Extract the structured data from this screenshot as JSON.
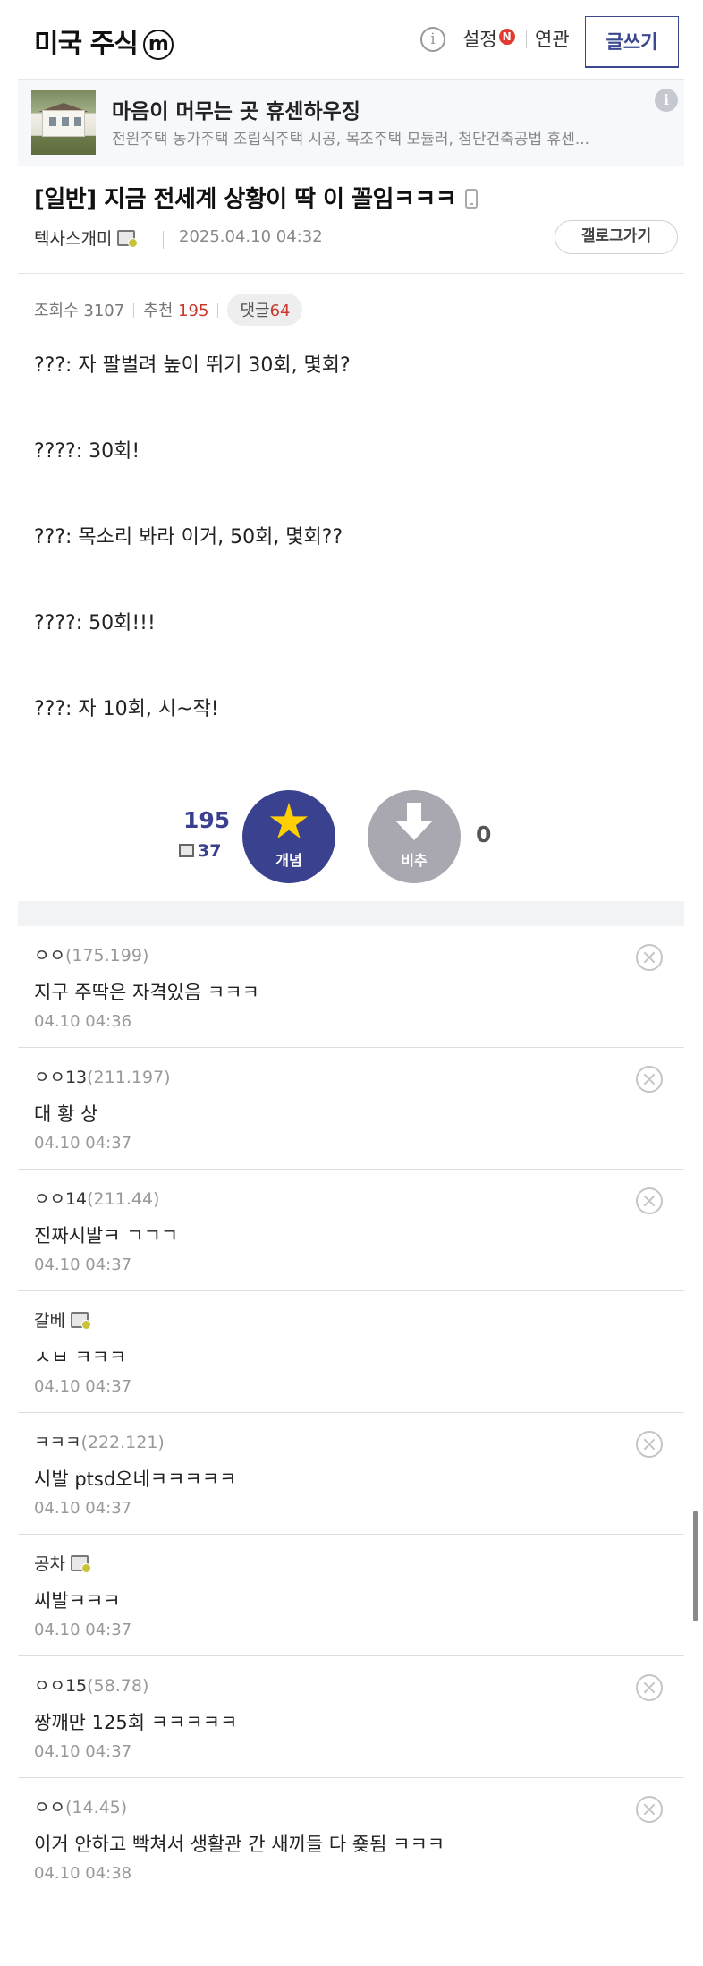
{
  "header": {
    "gallery_title": "미국 주식",
    "minor_badge": "m",
    "info_icon": "i",
    "settings_label": "설정",
    "new_badge": "N",
    "related_label": "연관",
    "write_label": "글쓰기"
  },
  "ad": {
    "title": "마음이 머무는 곳 휴센하우징",
    "description": "전원주택 농가주택 조립식주택 시공, 목조주택 모듈러, 첨단건축공법 휴센...",
    "info_icon": "i"
  },
  "post": {
    "title": "[일반] 지금 전세계 상황이 딱 이 꼴임ㅋㅋㅋ",
    "writer": "텍사스개미",
    "date": "2025.04.10 04:32",
    "gallery_button": "갤로그가기",
    "views_label": "조회수 3107",
    "recommend_label": "추천",
    "recommend_count": "195",
    "comments_label": "댓글",
    "comments_count": "64",
    "lines": [
      "???: 자 팔벌려 높이 뛰기 30회, 몇회?",
      "????: 30회!",
      "???: 목소리 봐라 이거, 50회, 몇회??",
      "????: 50회!!!",
      "???: 자 10회, 시~작!"
    ]
  },
  "vote": {
    "up_count": "195",
    "fixed_count": "37",
    "up_label": "개념",
    "down_label": "비추",
    "down_count": "0"
  },
  "comments": [
    {
      "name": "ㅇㅇ",
      "ip": "(175.199)",
      "text": "지구 주딱은 자격있음 ㅋㅋㅋ",
      "date": "04.10 04:36"
    },
    {
      "name": "ㅇㅇ13",
      "ip": "(211.197)",
      "text": "대 황 상",
      "date": "04.10 04:37"
    },
    {
      "name": "ㅇㅇ14",
      "ip": "(211.44)",
      "text": "진짜시발ㅋ ㄱㄱㄱ",
      "date": "04.10 04:37"
    },
    {
      "name": "갈베",
      "ip": "",
      "text": "ㅅㅂ ㅋㅋㅋ",
      "date": "04.10 04:37"
    },
    {
      "name": "ㅋㅋㅋ",
      "ip": "(222.121)",
      "text": "시발 ptsd오네ㅋㅋㅋㅋㅋ",
      "date": "04.10 04:37"
    },
    {
      "name": "공차",
      "ip": "",
      "text": "씨발ㅋㅋㅋ",
      "date": "04.10 04:37"
    },
    {
      "name": "ㅇㅇ15",
      "ip": "(58.78)",
      "text": "짱깨만 125회 ㅋㅋㅋㅋㅋ",
      "date": "04.10 04:37"
    },
    {
      "name": "ㅇㅇ",
      "ip": "(14.45)",
      "text": "이거 안하고 빡쳐서 생활관 간 새끼들 다 죶됨 ㅋㅋㅋ",
      "date": "04.10 04:38"
    }
  ]
}
